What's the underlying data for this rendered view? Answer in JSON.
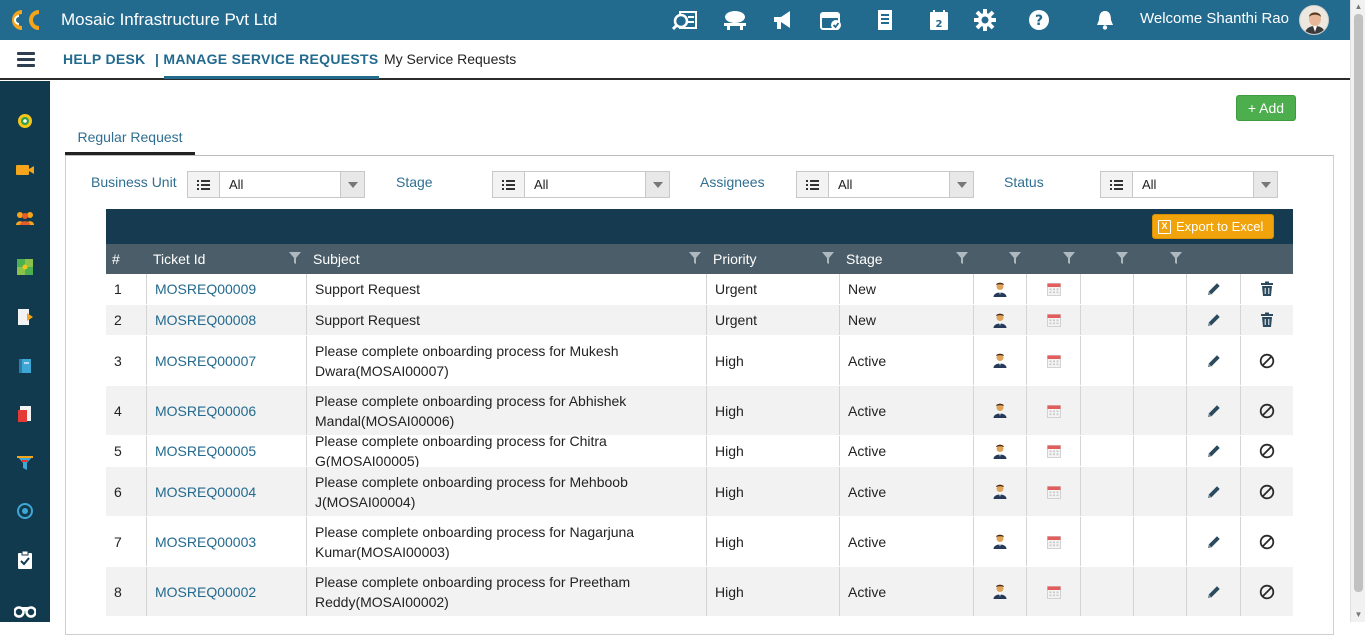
{
  "header": {
    "company": "Mosaic Infrastructure Pvt Ltd",
    "welcome": "Welcome Shanthi Rao",
    "icons": [
      "search-report-icon",
      "feedback-icon",
      "announcement-icon",
      "calendar-check-icon",
      "document-list-icon",
      "calendar-icon",
      "gear-icon",
      "help-icon",
      "bell-icon"
    ]
  },
  "breadcrumb": {
    "help_desk": "HELP DESK",
    "manage": "| MANAGE SERVICE REQUESTS",
    "my_requests": "My Service Requests"
  },
  "sidebar": {
    "icons": [
      "dashboard-icon",
      "video-icon",
      "team-icon",
      "puzzle-icon",
      "document-icon",
      "book-icon",
      "report-icon",
      "funnel-icon",
      "target-icon",
      "clipboard-icon",
      "binoculars-icon"
    ]
  },
  "actions": {
    "add_label": "+ Add",
    "export_label": "Export to Excel"
  },
  "tabs": {
    "regular": "Regular Request"
  },
  "filters": [
    {
      "label": "Business Unit",
      "value": "All"
    },
    {
      "label": "Stage",
      "value": "All"
    },
    {
      "label": "Assignees",
      "value": "All"
    },
    {
      "label": "Status",
      "value": "All"
    }
  ],
  "table": {
    "columns": [
      "#",
      "Ticket Id",
      "Subject",
      "Priority",
      "Stage"
    ],
    "rows": [
      {
        "num": "1",
        "ticket": "MOSREQ00009",
        "subject": "Support Request",
        "priority": "Urgent",
        "stage": "New",
        "last_action": "delete"
      },
      {
        "num": "2",
        "ticket": "MOSREQ00008",
        "subject": "Support Request",
        "priority": "Urgent",
        "stage": "New",
        "last_action": "delete"
      },
      {
        "num": "3",
        "ticket": "MOSREQ00007",
        "subject": "Please complete onboarding process for Mukesh Dwara(MOSAI00007)",
        "priority": "High",
        "stage": "Active",
        "last_action": "cancel"
      },
      {
        "num": "4",
        "ticket": "MOSREQ00006",
        "subject": "Please complete onboarding process for Abhishek Mandal(MOSAI00006)",
        "priority": "High",
        "stage": "Active",
        "last_action": "cancel"
      },
      {
        "num": "5",
        "ticket": "MOSREQ00005",
        "subject": "Please complete onboarding process for Chitra G(MOSAI00005)",
        "priority": "High",
        "stage": "Active",
        "last_action": "cancel"
      },
      {
        "num": "6",
        "ticket": "MOSREQ00004",
        "subject": "Please complete onboarding process for Mehboob J(MOSAI00004)",
        "priority": "High",
        "stage": "Active",
        "last_action": "cancel"
      },
      {
        "num": "7",
        "ticket": "MOSREQ00003",
        "subject": "Please complete onboarding process for Nagarjuna Kumar(MOSAI00003)",
        "priority": "High",
        "stage": "Active",
        "last_action": "cancel"
      },
      {
        "num": "8",
        "ticket": "MOSREQ00002",
        "subject": "Please complete onboarding process for Preetham Reddy(MOSAI00002)",
        "priority": "High",
        "stage": "Active",
        "last_action": "cancel"
      }
    ]
  },
  "colors": {
    "primary": "#236a8f",
    "sidebar": "#123a4f",
    "add_button": "#4cae4c",
    "export_button": "#f0a30a",
    "grid_header": "#4a5d69"
  }
}
